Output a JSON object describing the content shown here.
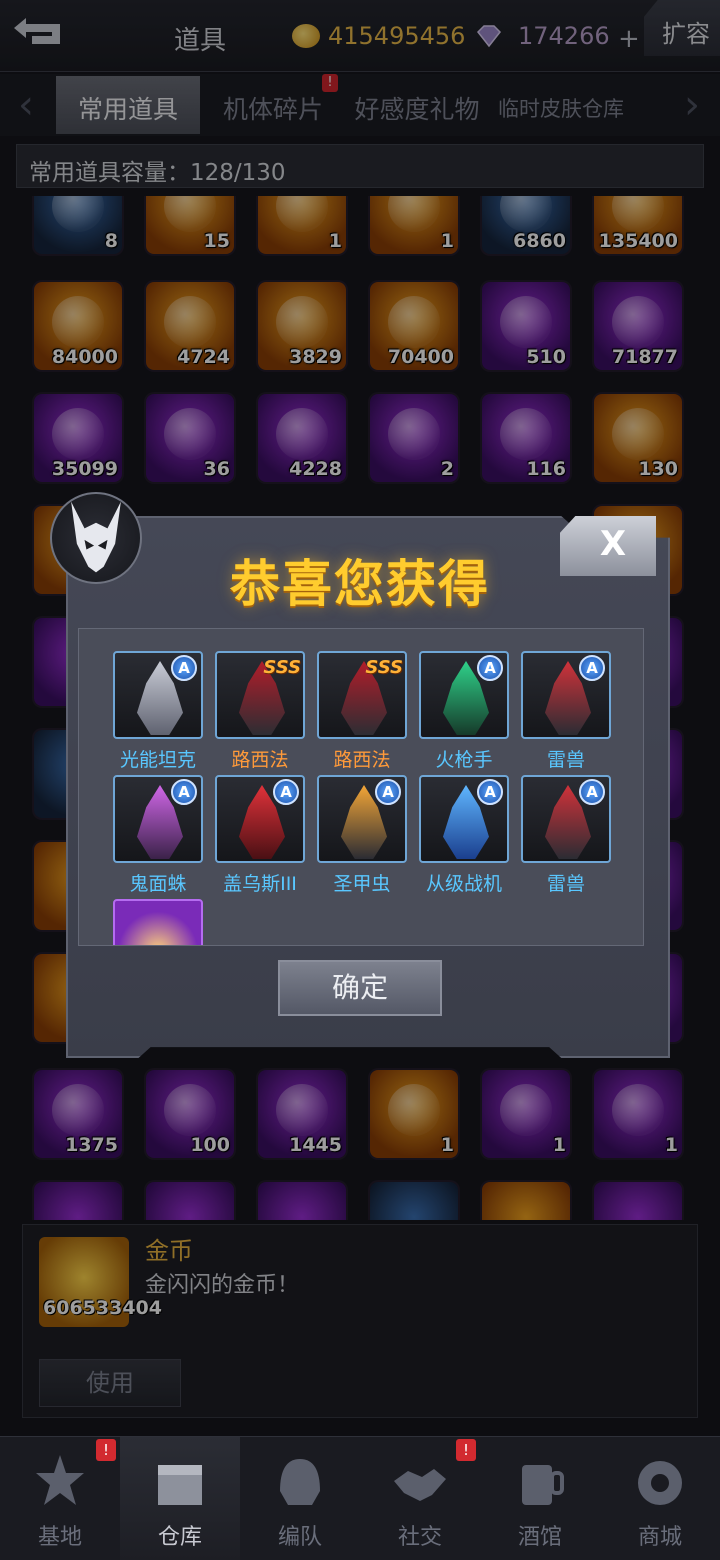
{
  "header": {
    "title": "道具",
    "gold": "415495456",
    "gems": "174266",
    "plus": "+",
    "expand": "扩容"
  },
  "tabs": [
    {
      "label": "常用道具",
      "active": true
    },
    {
      "label": "机体碎片",
      "badge": "!"
    },
    {
      "label": "好感度礼物"
    },
    {
      "label": "临时皮肤仓库"
    }
  ],
  "capacity": "常用道具容量：128/130",
  "grid": {
    "row1": [
      "8",
      "15",
      "1",
      "1",
      "6860",
      "135400"
    ],
    "row2": [
      "84000",
      "4724",
      "3829",
      "70400",
      "510",
      "71877"
    ],
    "row3": [
      "35099",
      "36",
      "4228",
      "2",
      "116",
      "130"
    ],
    "row10": [
      "1375",
      "100",
      "1445",
      "1",
      "1",
      "1"
    ]
  },
  "detail": {
    "name": "金币",
    "description": "金闪闪的金币！",
    "count": "606533404",
    "use_label": "使用"
  },
  "nav": [
    {
      "label": "基地",
      "badge": "!"
    },
    {
      "label": "仓库",
      "active": true
    },
    {
      "label": "编队"
    },
    {
      "label": "社交",
      "badge": "!"
    },
    {
      "label": "酒馆"
    },
    {
      "label": "商城"
    }
  ],
  "modal": {
    "title": "恭喜您获得",
    "close": "X",
    "confirm": "确定",
    "rewards": [
      {
        "name": "光能坦克",
        "grade": "A"
      },
      {
        "name": "路西法",
        "grade": "SSS"
      },
      {
        "name": "路西法",
        "grade": "SSS"
      },
      {
        "name": "火枪手",
        "grade": "A"
      },
      {
        "name": "雷兽",
        "grade": "A"
      },
      {
        "name": "鬼面蛛",
        "grade": "A"
      },
      {
        "name": "盖乌斯III",
        "grade": "A"
      },
      {
        "name": "圣甲虫",
        "grade": "A"
      },
      {
        "name": "从级战机",
        "grade": "A"
      },
      {
        "name": "雷兽",
        "grade": "A"
      }
    ]
  },
  "colors": {
    "gold_text": "#e8b94a",
    "title_gold": "#ffcc2e",
    "name_orange": "#ff9a3a",
    "name_cyan": "#59c7ff",
    "badge_red": "#d22a30"
  }
}
